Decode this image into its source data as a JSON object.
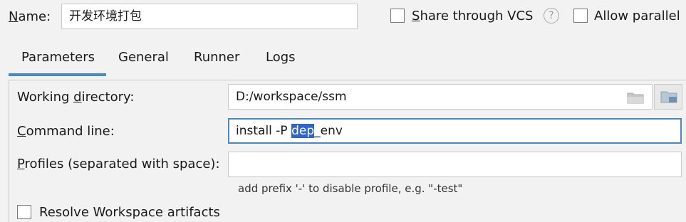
{
  "name": {
    "label_mnemonic": "N",
    "label_rest": "ame:",
    "value": "开发环境打包"
  },
  "options": {
    "share_mnemonic": "S",
    "share_rest": "hare through VCS",
    "help_glyph": "?",
    "allow_parallel": "Allow parallel"
  },
  "tabs": [
    {
      "label": "Parameters",
      "active": true
    },
    {
      "label": "General"
    },
    {
      "label": "Runner"
    },
    {
      "label": "Logs"
    }
  ],
  "params": {
    "working_directory": {
      "label_pre": "Working ",
      "label_mnemonic": "d",
      "label_post": "irectory:",
      "value": "D:/workspace/ssm"
    },
    "command_line": {
      "label_mnemonic": "C",
      "label_post": "ommand line:",
      "value_before": "install -P ",
      "value_selected": "dep",
      "value_after": "_env"
    },
    "profiles": {
      "label_mnemonic": "P",
      "label_post": "rofiles (separated with space):",
      "value": "",
      "hint": "add prefix '-' to disable profile, e.g. \"-test\""
    },
    "resolve_workspace": "Resolve Workspace artifacts"
  },
  "colors": {
    "accent": "#4a88c7",
    "selection": "#2f66c8"
  },
  "icons": {
    "folder": "folder-icon",
    "browse": "browse-icon",
    "help": "help-icon"
  }
}
